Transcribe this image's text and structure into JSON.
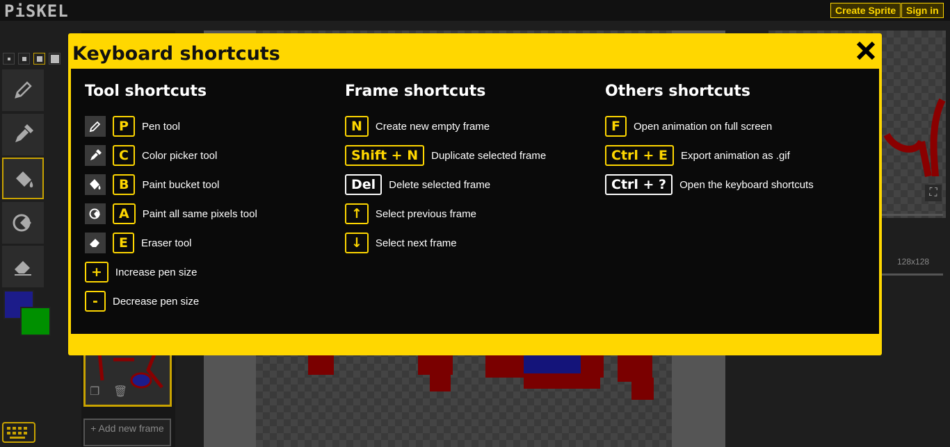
{
  "app": {
    "logo": "PiSKEL",
    "create_sprite": "Create Sprite",
    "sign_in": "Sign in",
    "add_frame": "+ Add new frame",
    "resize_label": "128x128"
  },
  "dialog": {
    "title": "Keyboard shortcuts",
    "close_icon": "close-icon",
    "columns": {
      "tool": {
        "heading": "Tool shortcuts",
        "items": [
          {
            "icon": "pen-icon",
            "key": "P",
            "desc": "Pen tool"
          },
          {
            "icon": "color-picker-icon",
            "key": "C",
            "desc": "Color picker tool"
          },
          {
            "icon": "paint-bucket-icon",
            "key": "B",
            "desc": "Paint bucket tool"
          },
          {
            "icon": "paint-all-icon",
            "key": "A",
            "desc": "Paint all same pixels tool"
          },
          {
            "icon": "eraser-icon",
            "key": "E",
            "desc": "Eraser tool"
          },
          {
            "key": "+",
            "desc": "Increase pen size"
          },
          {
            "key": "-",
            "desc": "Decrease pen size"
          }
        ]
      },
      "frame": {
        "heading": "Frame shortcuts",
        "items": [
          {
            "key": "N",
            "desc": "Create new empty frame"
          },
          {
            "key": "Shift + N",
            "desc": "Duplicate selected frame"
          },
          {
            "key": "Del",
            "desc": "Delete selected frame",
            "white": true
          },
          {
            "key": "↑",
            "desc": "Select previous frame"
          },
          {
            "key": "↓",
            "desc": "Select next frame"
          }
        ]
      },
      "other": {
        "heading": "Others shortcuts",
        "items": [
          {
            "key": "F",
            "desc": "Open animation on full screen"
          },
          {
            "key": "Ctrl + E",
            "desc": "Export animation as .gif"
          },
          {
            "key": "Ctrl + ?",
            "desc": "Open the keyboard shortcuts",
            "white": true
          }
        ]
      }
    }
  },
  "colors": {
    "accent": "#ffd700",
    "primary_color": "#1c1c8a",
    "secondary_color": "#009000"
  }
}
